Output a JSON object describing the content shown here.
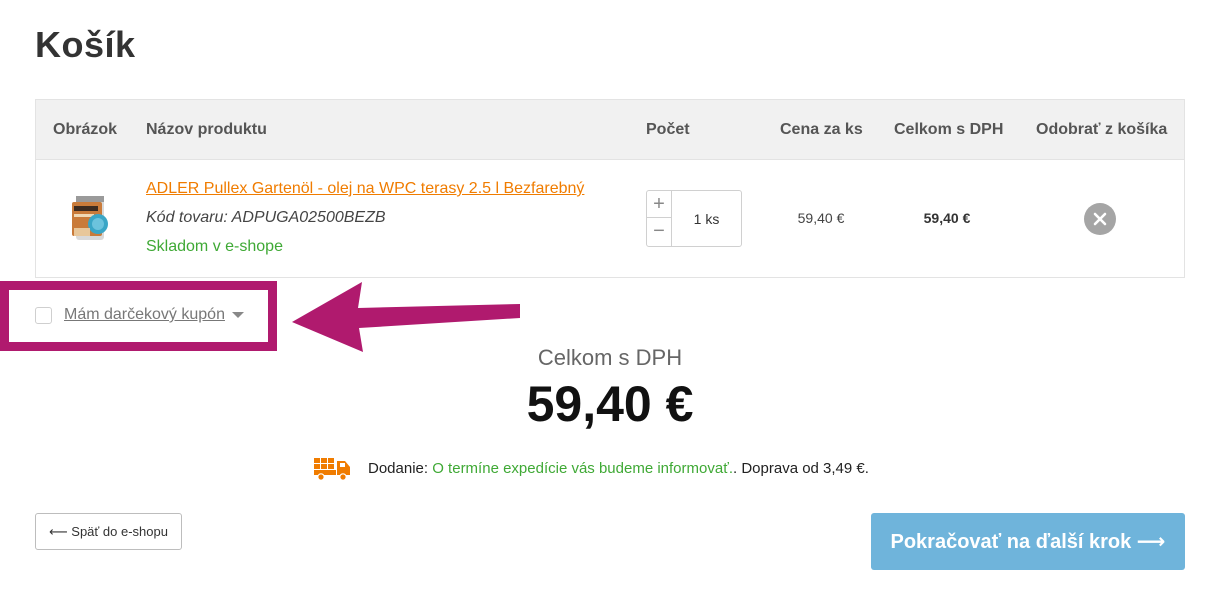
{
  "page": {
    "title": "Košík"
  },
  "table": {
    "headers": {
      "image": "Obrázok",
      "name": "Názov produktu",
      "qty": "Počet",
      "unit_price": "Cena za ks",
      "total": "Celkom s DPH",
      "remove": "Odobrať z košíka"
    },
    "items": [
      {
        "name": "ADLER Pullex Gartenöl - olej na WPC terasy 2.5 l Bezfarebný",
        "code": "Kód tovaru: ADPUGA02500BEZB",
        "stock": "Skladom v e-shope",
        "qty": "1 ks",
        "unit_price": "59,40 €",
        "total": "59,40 €"
      }
    ]
  },
  "coupon": {
    "label": "Mám darčekový kupón"
  },
  "summary": {
    "label": "Celkom s DPH",
    "total": "59,40 €"
  },
  "delivery": {
    "prefix": "Dodanie: ",
    "info": "O termíne expedície vás budeme informovať.",
    "suffix": ". Doprava od 3,49 €."
  },
  "buttons": {
    "back": "⟵ Späť do e-shopu",
    "next": "Pokračovať na ďalší krok ⟶"
  },
  "icons": {
    "delivery": "truck-icon",
    "remove": "close-icon",
    "annotation": "arrow-left-icon"
  },
  "colors": {
    "accent": "#f07c00",
    "stock_green": "#3fa935",
    "next_button": "#6fb4db",
    "highlight": "#b01a6e",
    "remove_button": "#a5a5a5"
  }
}
